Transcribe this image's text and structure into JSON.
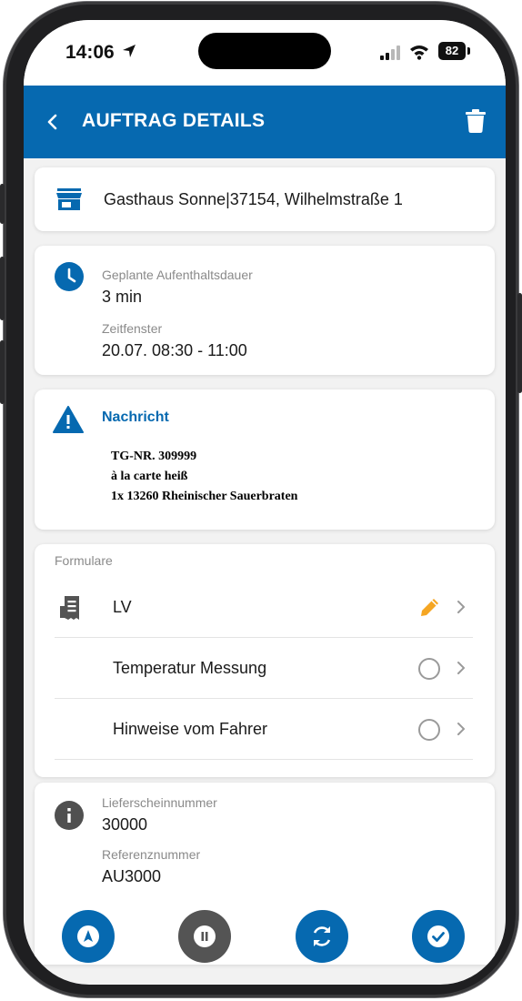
{
  "status_bar": {
    "time": "14:06",
    "battery": "82",
    "icons": [
      "location-arrow-icon",
      "signal-icon",
      "wifi-icon",
      "battery-icon"
    ]
  },
  "app_bar": {
    "title": "AUFTRAG DETAILS",
    "back_icon": "chevron-left-icon",
    "delete_icon": "trash-icon",
    "background": "#0669b0"
  },
  "store": {
    "icon": "store-icon",
    "address": "Gasthaus Sonne|37154, Wilhelmstraße 1"
  },
  "schedule": {
    "icon": "clock-icon",
    "duration_label": "Geplante Aufenthaltsdauer",
    "duration_value": "3 min",
    "window_label": "Zeitfenster",
    "window_value": "20.07. 08:30 - 11:00"
  },
  "message": {
    "icon": "warning-icon",
    "title": "Nachricht",
    "lines": [
      "TG-NR. 309999",
      "à la carte heiß",
      "1x 13260 Rheinischer Sauerbraten"
    ]
  },
  "forms": {
    "heading": "Formulare",
    "items": [
      {
        "label": "LV",
        "icon": "receipt-icon",
        "status": "pencil-icon"
      },
      {
        "label": "Temperatur Messung",
        "status": "empty-circle-icon"
      },
      {
        "label": "Hinweise vom Fahrer",
        "status": "empty-circle-icon"
      }
    ]
  },
  "references": {
    "icon": "info-icon",
    "delivery_note_label": "Lieferscheinnummer",
    "delivery_note_value": "30000",
    "reference_label": "Referenznummer",
    "reference_value": "AU3000"
  },
  "actions": [
    {
      "name": "navigate-button",
      "icon": "navigation-arrow-icon",
      "color": "#0669b0"
    },
    {
      "name": "pause-button",
      "icon": "pause-icon",
      "color": "#545454"
    },
    {
      "name": "sync-button",
      "icon": "sync-icon",
      "color": "#0669b0"
    },
    {
      "name": "complete-button",
      "icon": "check-icon",
      "color": "#0669b0"
    }
  ],
  "colors": {
    "primary": "#0669b0",
    "pencil": "#f5a623",
    "background": "#f2f2f2"
  }
}
